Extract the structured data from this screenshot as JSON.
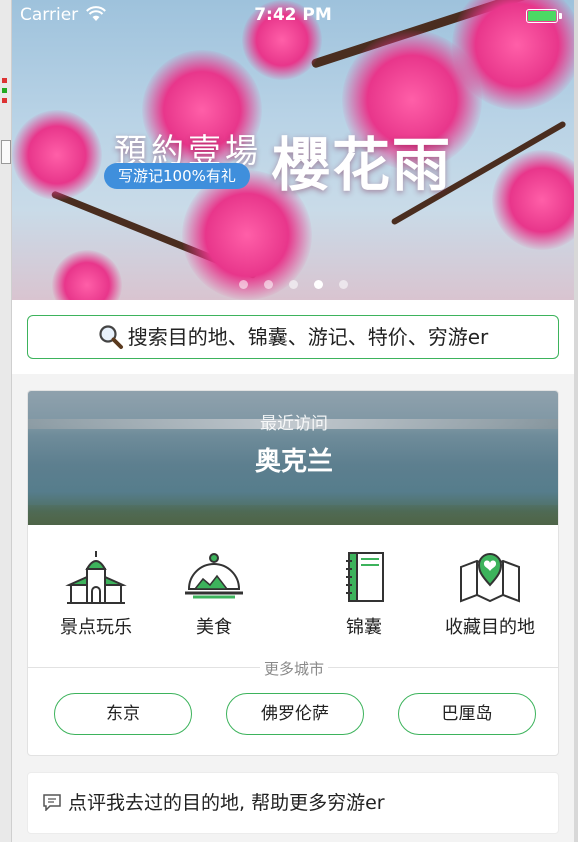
{
  "status_bar": {
    "carrier": "Carrier",
    "time": "7:42 PM"
  },
  "banner": {
    "subtitle": "預約壹場",
    "title": "櫻花雨",
    "tag": "写游记100%有礼",
    "dots": 5,
    "active_dot": 4
  },
  "search": {
    "placeholder": "搜索目的地、锦囊、游记、特价、穷游er"
  },
  "recent": {
    "label": "最近访问",
    "city": "奥克兰"
  },
  "categories": [
    {
      "label": "景点玩乐",
      "icon": "attraction-icon"
    },
    {
      "label": "美食",
      "icon": "food-cloche-icon"
    },
    {
      "label": "锦囊",
      "icon": "guidebook-icon"
    },
    {
      "label": "收藏目的地",
      "icon": "map-heart-icon"
    }
  ],
  "more_cities": {
    "label": "更多城市",
    "cities": [
      "东京",
      "佛罗伦萨",
      "巴厘岛"
    ]
  },
  "review": {
    "text": "点评我去过的目的地, 帮助更多穷游er"
  },
  "colors": {
    "accent": "#3db35c",
    "pill": "#3f8fdc",
    "battery": "#4cd964"
  }
}
